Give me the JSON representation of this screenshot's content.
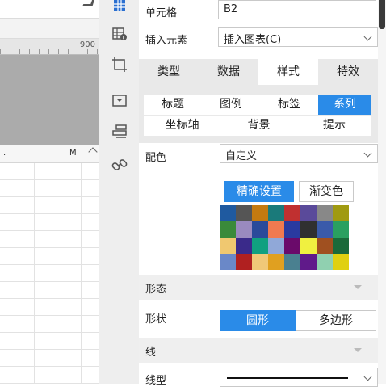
{
  "canvas": {
    "ruler_mark": "900",
    "column_headers": [
      ".",
      "M"
    ]
  },
  "icon_strip": [
    "grid-icon",
    "table-info-icon",
    "crop-frame-icon",
    "dropdown-widget-icon",
    "layers-icon",
    "link-icon"
  ],
  "panel": {
    "cell_label": "单元格",
    "cell_value": "B2",
    "insert_label": "插入元素",
    "insert_value": "插入图表(C)",
    "main_tabs": [
      "类型",
      "数据",
      "样式",
      "特效"
    ],
    "main_tab_active": "样式",
    "sub_tabs_row1": [
      "标题",
      "图例",
      "标签",
      "系列"
    ],
    "sub_tabs_row2": [
      "坐标轴",
      "背景",
      "提示"
    ],
    "sub_tab_active": "系列",
    "color_label": "配色",
    "color_value": "自定义",
    "color_mode_buttons": [
      "精确设置",
      "渐变色"
    ],
    "color_mode_active": "精确设置",
    "palette": [
      "#1f5aa0",
      "#555555",
      "#c47a10",
      "#1a7a7a",
      "#c03030",
      "#5a4a9a",
      "#888888",
      "#a09a10",
      "#3a8a3a",
      "#9a8abf",
      "#2a4a9a",
      "#f07a50",
      "#2a3aa0",
      "#303030",
      "#3a5aaa",
      "#2aa060",
      "#f0c870",
      "#3a2a8a",
      "#10a080",
      "#90a8d8",
      "#6a0a6a",
      "#f0f040",
      "#a05020",
      "#1a6a3a",
      "#6a88c8",
      "#b02020",
      "#f0c878",
      "#e0a020",
      "#4a8090",
      "#601a8a",
      "#90d0b0",
      "#e0d010"
    ],
    "shape_section": "形态",
    "shape_label": "形状",
    "shape_buttons": [
      "圆形",
      "多边形"
    ],
    "shape_active": "圆形",
    "line_section": "线",
    "line_type_label": "线型",
    "accent_color": "#2a8be8"
  }
}
